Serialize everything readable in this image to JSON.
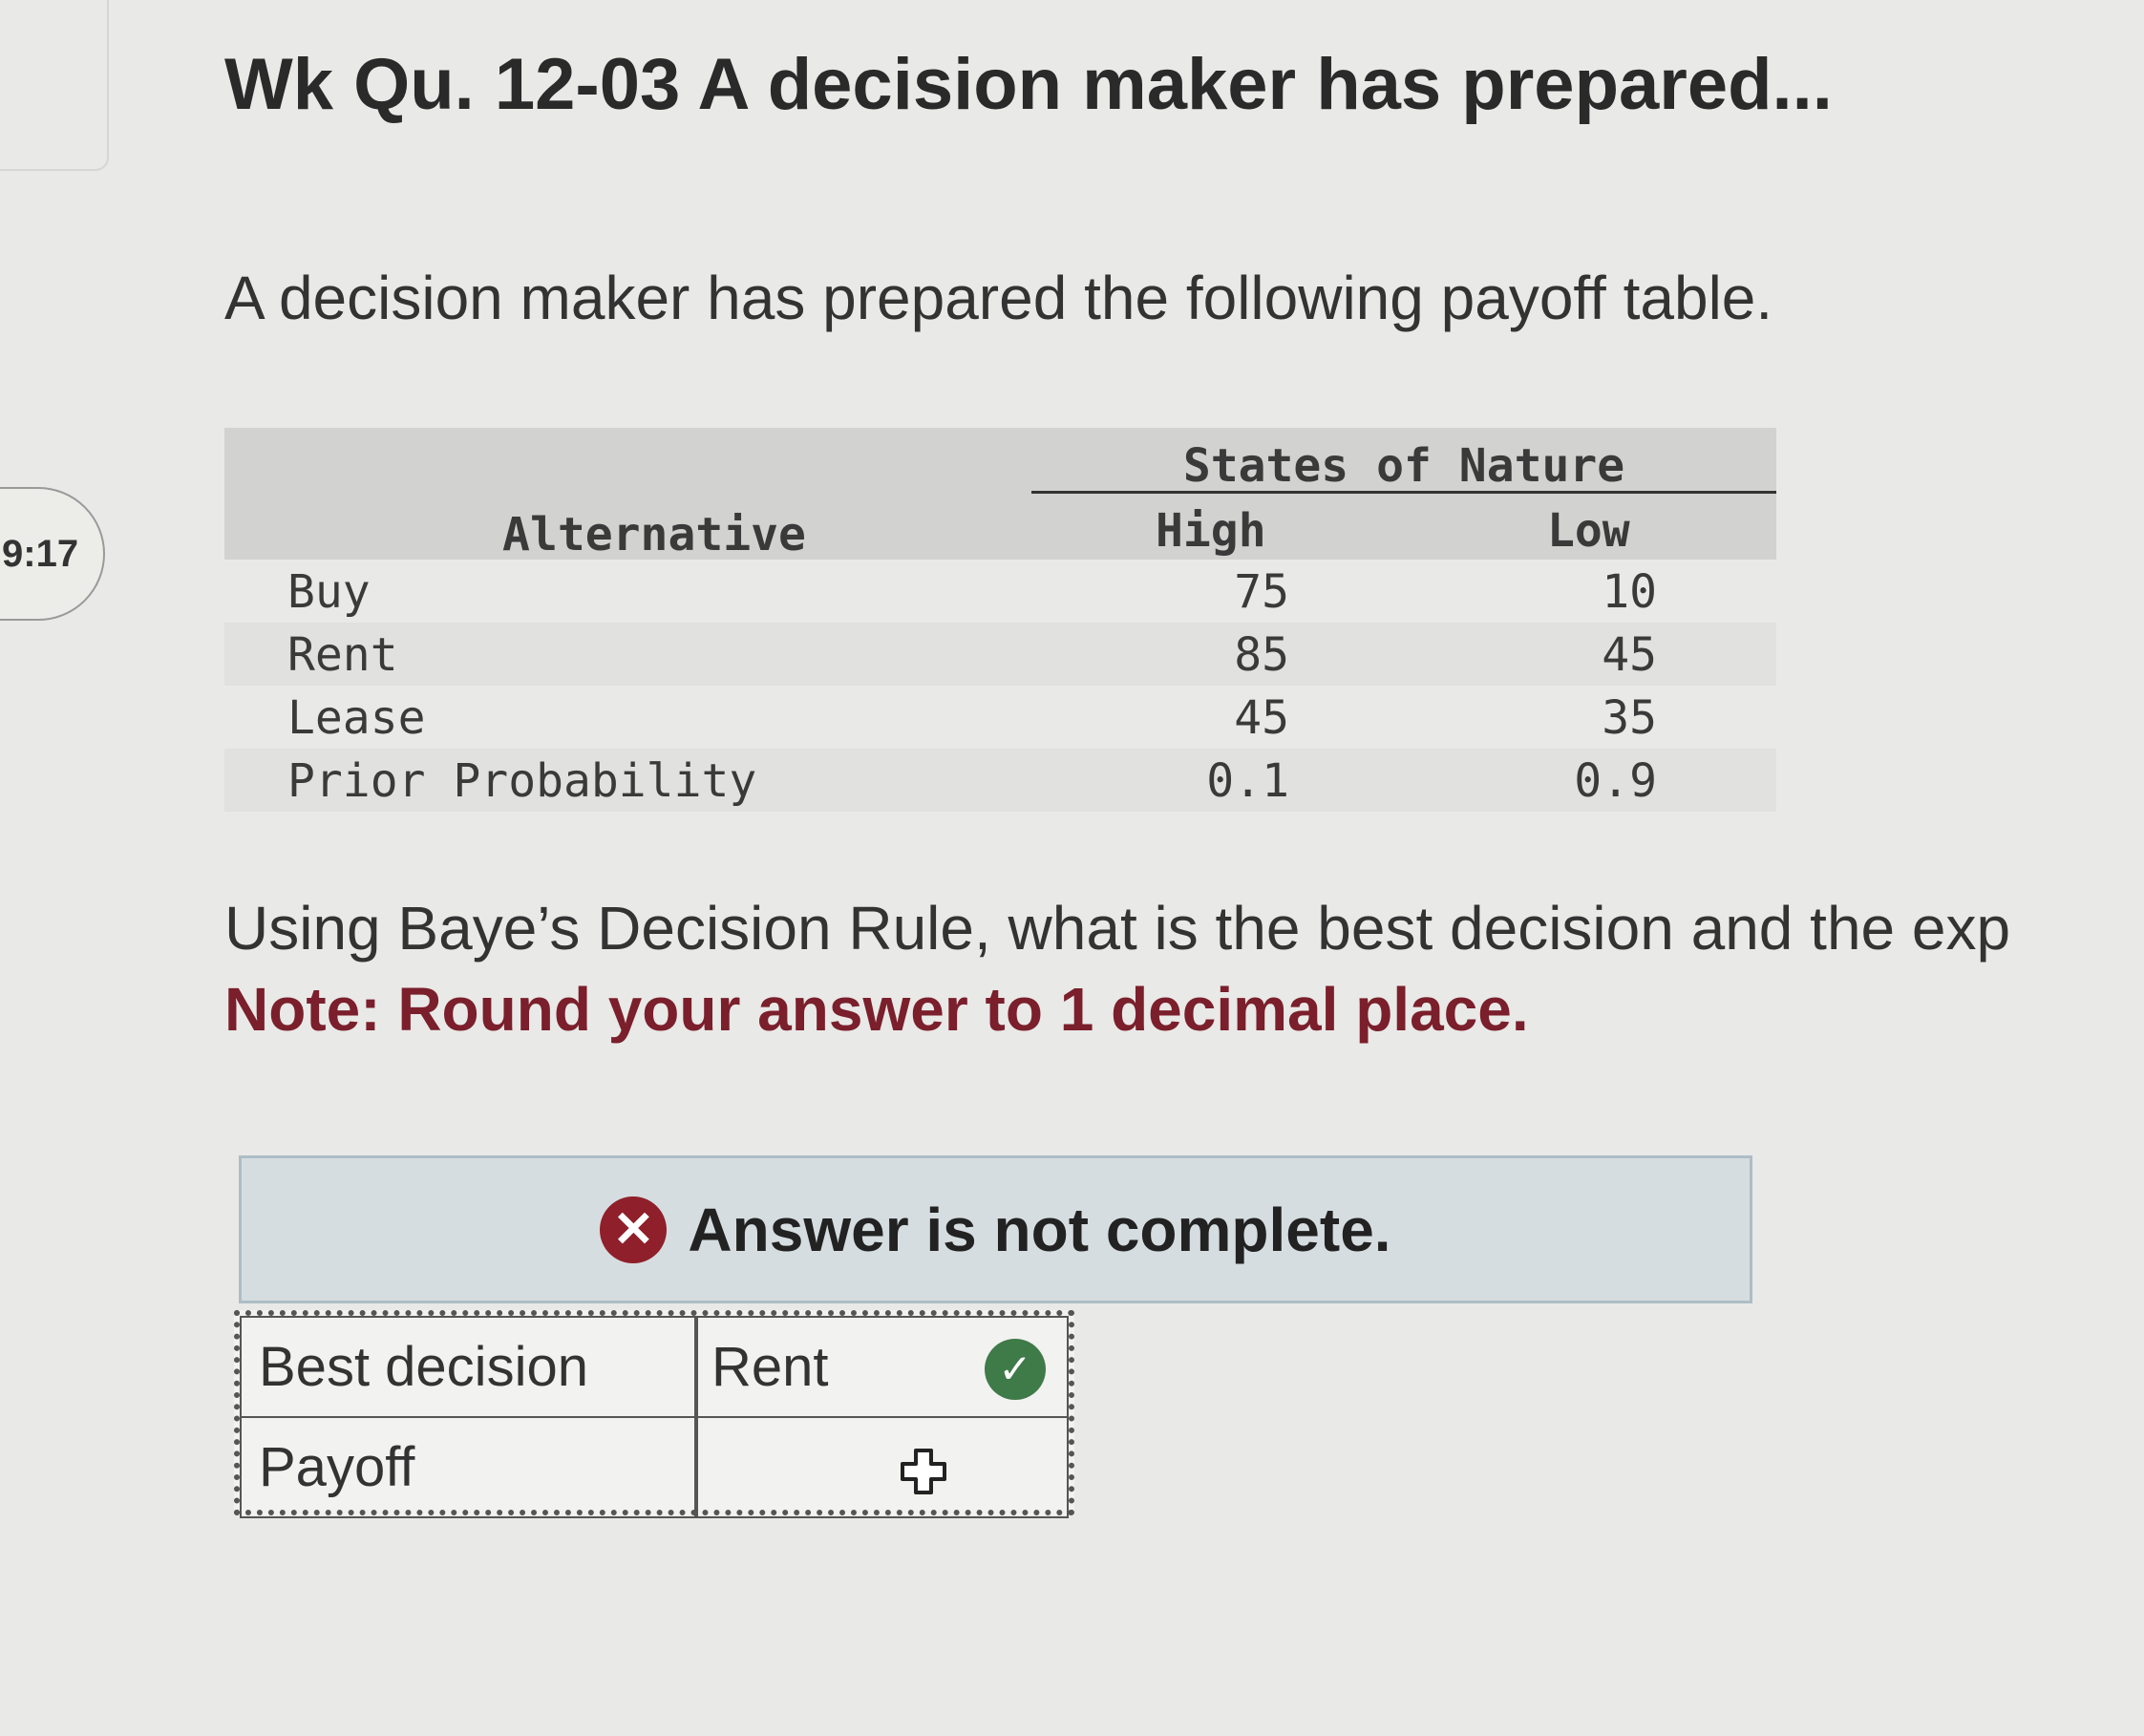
{
  "timer": "9:17",
  "title": "Wk Qu. 12-03 A decision maker has prepared...",
  "intro": "A decision maker has prepared the following payoff table.",
  "payoff_table": {
    "alternative_header": "Alternative",
    "states_header": "States of Nature",
    "columns": [
      "High",
      "Low"
    ],
    "rows": [
      {
        "label": "Buy",
        "high": "75",
        "low": "10"
      },
      {
        "label": "Rent",
        "high": "85",
        "low": "45"
      },
      {
        "label": "Lease",
        "high": "45",
        "low": "35"
      },
      {
        "label": "Prior Probability",
        "high": "0.1",
        "low": "0.9"
      }
    ]
  },
  "question": "Using Baye’s Decision Rule, what is the best decision and the exp",
  "note": "Note: Round your answer to 1 decimal place.",
  "banner": "Answer is not complete.",
  "answer_table": {
    "rows": [
      {
        "label": "Best decision",
        "value": "Rent",
        "status": "correct"
      },
      {
        "label": "Payoff",
        "value": "",
        "status": "empty"
      }
    ]
  },
  "colors": {
    "note": "#7a1f2b",
    "error_icon": "#8f1f2a",
    "correct_icon": "#3f7a49",
    "banner_bg": "#d6dde0"
  },
  "icons": [
    "close-circle-icon",
    "check-circle-icon",
    "move-cursor-icon"
  ]
}
